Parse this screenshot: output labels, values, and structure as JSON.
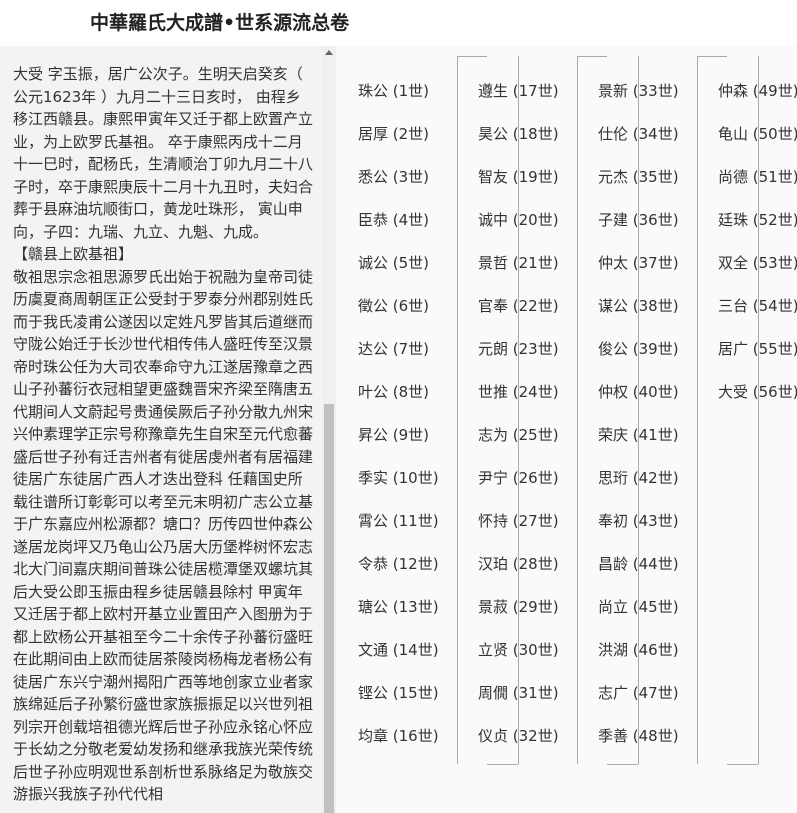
{
  "title": "中華羅氏大成譜•世系源流总卷",
  "biography": "大受  字玉振，居广公次子。生明天启癸亥（ 公元1623年 ）九月二十三日亥时，  由程乡移江西赣县。康熙甲寅年又迁于都上欧置产立业，为上欧罗氏基祖。   卒于康熙丙戌十二月十一巳时，配杨氏，生清顺治丁卯九月二十八子时，卒于康熙庚辰十二月十九丑时，夫妇合葬于县麻油坑顺街口，黄龙吐珠形，    寅山申向，子四：九瑞、九立、九魁、九成。\n【赣县上欧基祖】\n敬祖思宗念祖思源罗氏出始于祝融为皇帝司徒历虞夏商周朝匡正公受封于罗泰分州郡别姓氏而于我氏凌甫公遂因以定姓凡罗皆其后道继而守陇公始迁于长沙世代相传伟人盛旺传至汉景帝时珠公任为大司农奉命守九江遂居豫章之西山子孙蕃衍衣冠相望更盛魏晋宋齐梁至隋唐五代期间人文蔚起号贵通侯厥后子孙分散九州宋兴仲素理学正宗号称豫章先生自宋至元代愈蕃盛后世子孙有迁吉州者有徙居虔州者有居福建徒居广东徒居广西人才迭出登科  任藉国史所载往谱所订彰彰可以考至元末明初广志公立基于广东嘉应州松源都？塘口？历传四世仲森公遂居龙岗坪又乃龟山公乃居大历堡桦树怀宏志北大门间嘉庆期间普珠公徒居榄潭堡双螺坑其后大受公即玉振由程乡徒居赣县除村  甲寅年又迁居于都上欧村开基立业置田产入图册为于都上欧杨公开基祖至今二十余传子孙蕃衍盛旺在此期间由上欧而徒居茶陵岗杨梅龙者杨公有徒居广东兴宁潮州揭阳广西等地创家立业者家族绵延后子孙繁衍盛世家族振振足以兴世列祖列宗开创载培祖德光辉后世子孙应永铭心怀应于长幼之分敬老爱幼发扬和继承我族光荣传统后世子孙应明观世系剖析世系脉络足为敬族交游振兴我族子孙代代相",
  "generation_columns": [
    [
      "珠公 (1世)",
      "居厚 (2世)",
      "悉公 (3世)",
      "臣恭 (4世)",
      "诚公 (5世)",
      "徵公 (6世)",
      "达公 (7世)",
      "叶公 (8世)",
      "昇公 (9世)",
      "季实 (10世)",
      "霄公 (11世)",
      "令恭 (12世)",
      "瑭公 (13世)",
      "文通 (14世)",
      "铿公 (15世)",
      "均章 (16世)"
    ],
    [
      "遵生 (17世)",
      "昊公 (18世)",
      "智友 (19世)",
      "诚中 (20世)",
      "景哲 (21世)",
      "官奉 (22世)",
      "元朗 (23世)",
      "世推 (24世)",
      "志为 (25世)",
      "尹宁 (26世)",
      "怀持 (27世)",
      "汉珀 (28世)",
      "景菽 (29世)",
      "立贤 (30世)",
      "周僩 (31世)",
      "仪贞 (32世)"
    ],
    [
      "景新 (33世)",
      "仕伦 (34世)",
      "元杰 (35世)",
      "子建 (36世)",
      "仲太 (37世)",
      "谋公 (38世)",
      "俊公 (39世)",
      "仲权 (40世)",
      "荣庆 (41世)",
      "思珩 (42世)",
      "奉初 (43世)",
      "昌龄 (44世)",
      "尚立 (45世)",
      "洪湖 (46世)",
      "志广 (47世)",
      "季善 (48世)"
    ],
    [
      "仲森 (49世)",
      "龟山 (50世)",
      "尚德 (51世)",
      "廷珠 (52世)",
      "双全 (53世)",
      "三台 (54世)",
      "居广 (55世)",
      "大受 (56世)"
    ]
  ]
}
